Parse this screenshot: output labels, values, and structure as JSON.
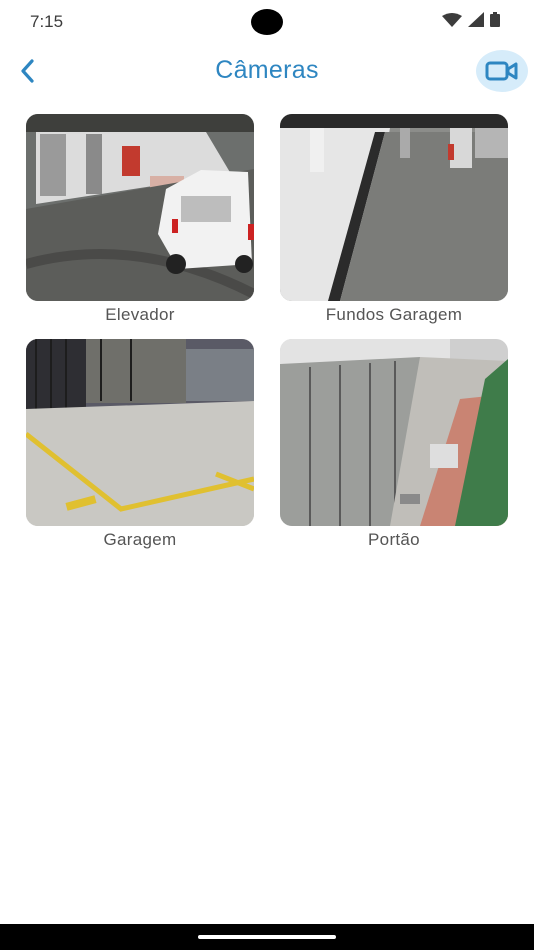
{
  "status_bar": {
    "time": "7:15",
    "icons": [
      "wifi-icon",
      "cellular-signal-icon",
      "battery-icon"
    ]
  },
  "header": {
    "back_icon": "chevron-left-icon",
    "title": "Câmeras",
    "action_icon": "video-camera-icon"
  },
  "cameras": [
    {
      "label": "Elevador"
    },
    {
      "label": "Fundos Garagem"
    },
    {
      "label": "Garagem"
    },
    {
      "label": "Portão"
    }
  ],
  "colors": {
    "accent": "#2e86c1",
    "action_bg": "#d6ecfa",
    "label_text": "#555555"
  }
}
